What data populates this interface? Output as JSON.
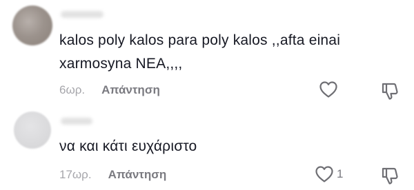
{
  "comments": [
    {
      "username": "··········",
      "text_line1": "kalos poly kalos para poly kalos ,,afta einai",
      "text_line2": "xarmosyna NEA,,,,",
      "time": "6ωρ.",
      "reply_label": "Απάντηση",
      "like_count": "",
      "like_icon": "heart-outline-icon",
      "dislike_icon": "thumbs-down-icon"
    },
    {
      "username": "·······",
      "text_line1": "να και κάτι ευχάριστο",
      "time": "17ωρ.",
      "reply_label": "Απάντηση",
      "like_count": "1",
      "like_icon": "heart-outline-icon",
      "dislike_icon": "thumbs-down-icon"
    }
  ],
  "colors": {
    "text": "#161823",
    "time": "#a6a6ab",
    "reply": "#7a7a80",
    "icon": "#6e6e73"
  }
}
